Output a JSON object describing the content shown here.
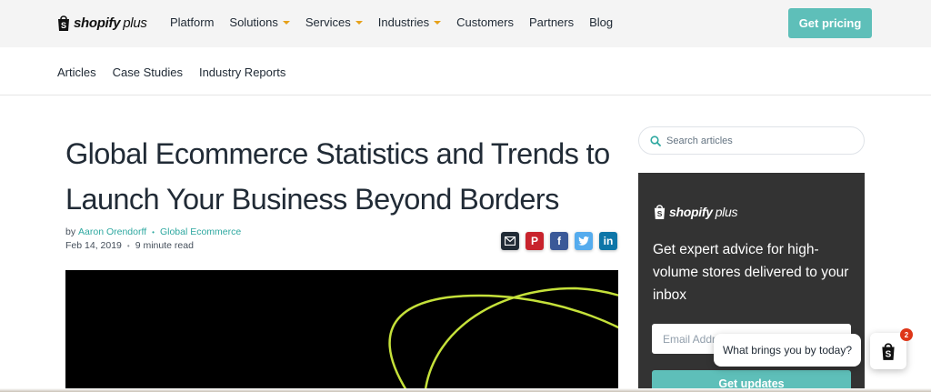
{
  "header": {
    "logo_word": "shopify",
    "logo_plus": "plus",
    "nav": [
      {
        "label": "Platform",
        "dropdown": false
      },
      {
        "label": "Solutions",
        "dropdown": true
      },
      {
        "label": "Services",
        "dropdown": true
      },
      {
        "label": "Industries",
        "dropdown": true
      },
      {
        "label": "Customers",
        "dropdown": false
      },
      {
        "label": "Partners",
        "dropdown": false
      },
      {
        "label": "Blog",
        "dropdown": false
      }
    ],
    "cta_label": "Get pricing"
  },
  "subnav": {
    "items": [
      "Articles",
      "Case Studies",
      "Industry Reports"
    ]
  },
  "article": {
    "title": "Global Ecommerce Statistics and Trends to Launch Your Business Beyond Borders",
    "by": "by",
    "author": "Aaron Orendorff",
    "category": "Global Ecommerce",
    "date": "Feb 14, 2019",
    "read_time": "9 minute read",
    "share_icons": [
      "mail-icon",
      "pinterest-icon",
      "facebook-icon",
      "twitter-icon",
      "linkedin-icon"
    ]
  },
  "sidebar": {
    "search_placeholder": "Search articles",
    "promo": {
      "logo_word": "shopify",
      "logo_plus": "plus",
      "headline": "Get expert advice for high-volume stores delivered to your inbox",
      "email_placeholder": "Email Address",
      "submit_label": "Get updates"
    }
  },
  "chat": {
    "prompt": "What brings you by today?",
    "badge_count": "2"
  },
  "colors": {
    "accent": "#5ebfb9",
    "link": "#2ea8a0",
    "caret": "#e6a11a",
    "promo_bg": "#333333",
    "hero_curve": "#c5e13a"
  }
}
